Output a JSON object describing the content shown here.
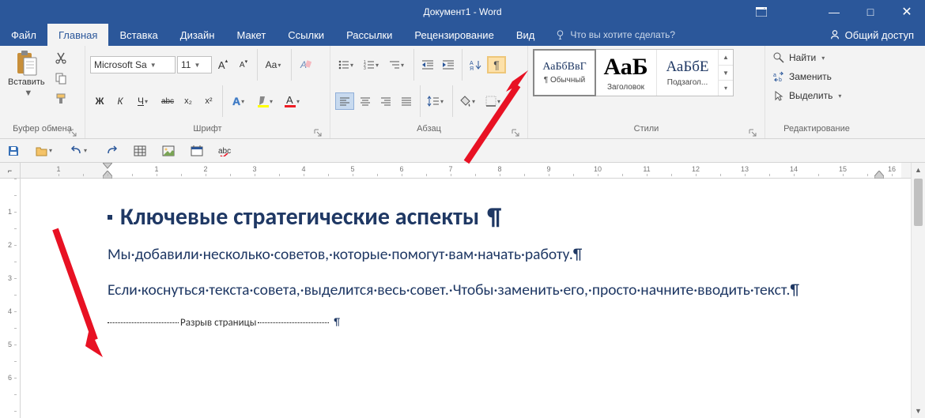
{
  "titlebar": {
    "title": "Документ1 - Word"
  },
  "window_controls": {
    "minimize": "—",
    "maximize": "□",
    "close": "✕"
  },
  "tabs": {
    "file": "Файл",
    "home": "Главная",
    "insert": "Вставка",
    "design": "Дизайн",
    "layout": "Макет",
    "references": "Ссылки",
    "mailings": "Рассылки",
    "review": "Рецензирование",
    "view": "Вид",
    "tell_me": "Что вы хотите сделать?",
    "share": "Общий доступ"
  },
  "ribbon": {
    "clipboard": {
      "label": "Буфер обмена",
      "paste": "Вставить"
    },
    "font": {
      "label": "Шрифт",
      "name": "Microsoft Sa",
      "size": "11",
      "bold": "Ж",
      "italic": "К",
      "underline": "Ч",
      "strike": "abc",
      "sub": "x₂",
      "sup": "x²"
    },
    "paragraph": {
      "label": "Абзац"
    },
    "styles": {
      "label": "Стили",
      "items": [
        {
          "preview": "АаБбВвГ",
          "name": "¶ Обычный",
          "preview_size": "14px",
          "selected": true
        },
        {
          "preview": "АаБ",
          "name": "Заголовок",
          "preview_size": "30px",
          "bold": true,
          "selected": false
        },
        {
          "preview": "АаБбЕ",
          "name": "Подзагол...",
          "preview_size": "19px",
          "selected": false
        }
      ]
    },
    "editing": {
      "label": "Редактирование",
      "find": "Найти",
      "replace": "Заменить",
      "select": "Выделить"
    }
  },
  "ruler": {
    "corner": "⌐",
    "numbers": [
      1,
      1,
      2,
      3,
      4,
      5,
      6,
      7,
      8,
      9,
      10,
      11,
      12,
      13,
      14,
      15,
      16
    ]
  },
  "ruler_v": {
    "numbers": [
      1,
      2,
      3,
      4,
      5,
      6
    ]
  },
  "document": {
    "heading": "Ключевые стратегические аспекты",
    "p1": "Мы·добавили·несколько·советов,·которые·помогут·вам·начать·работу.",
    "p2": "Если·коснуться·текста·совета,·выделится·весь·совет.·Чтобы·заменить·его,·просто·начните·вводить·текст.",
    "page_break": "Разрыв страницы",
    "pilcrow": "¶"
  }
}
